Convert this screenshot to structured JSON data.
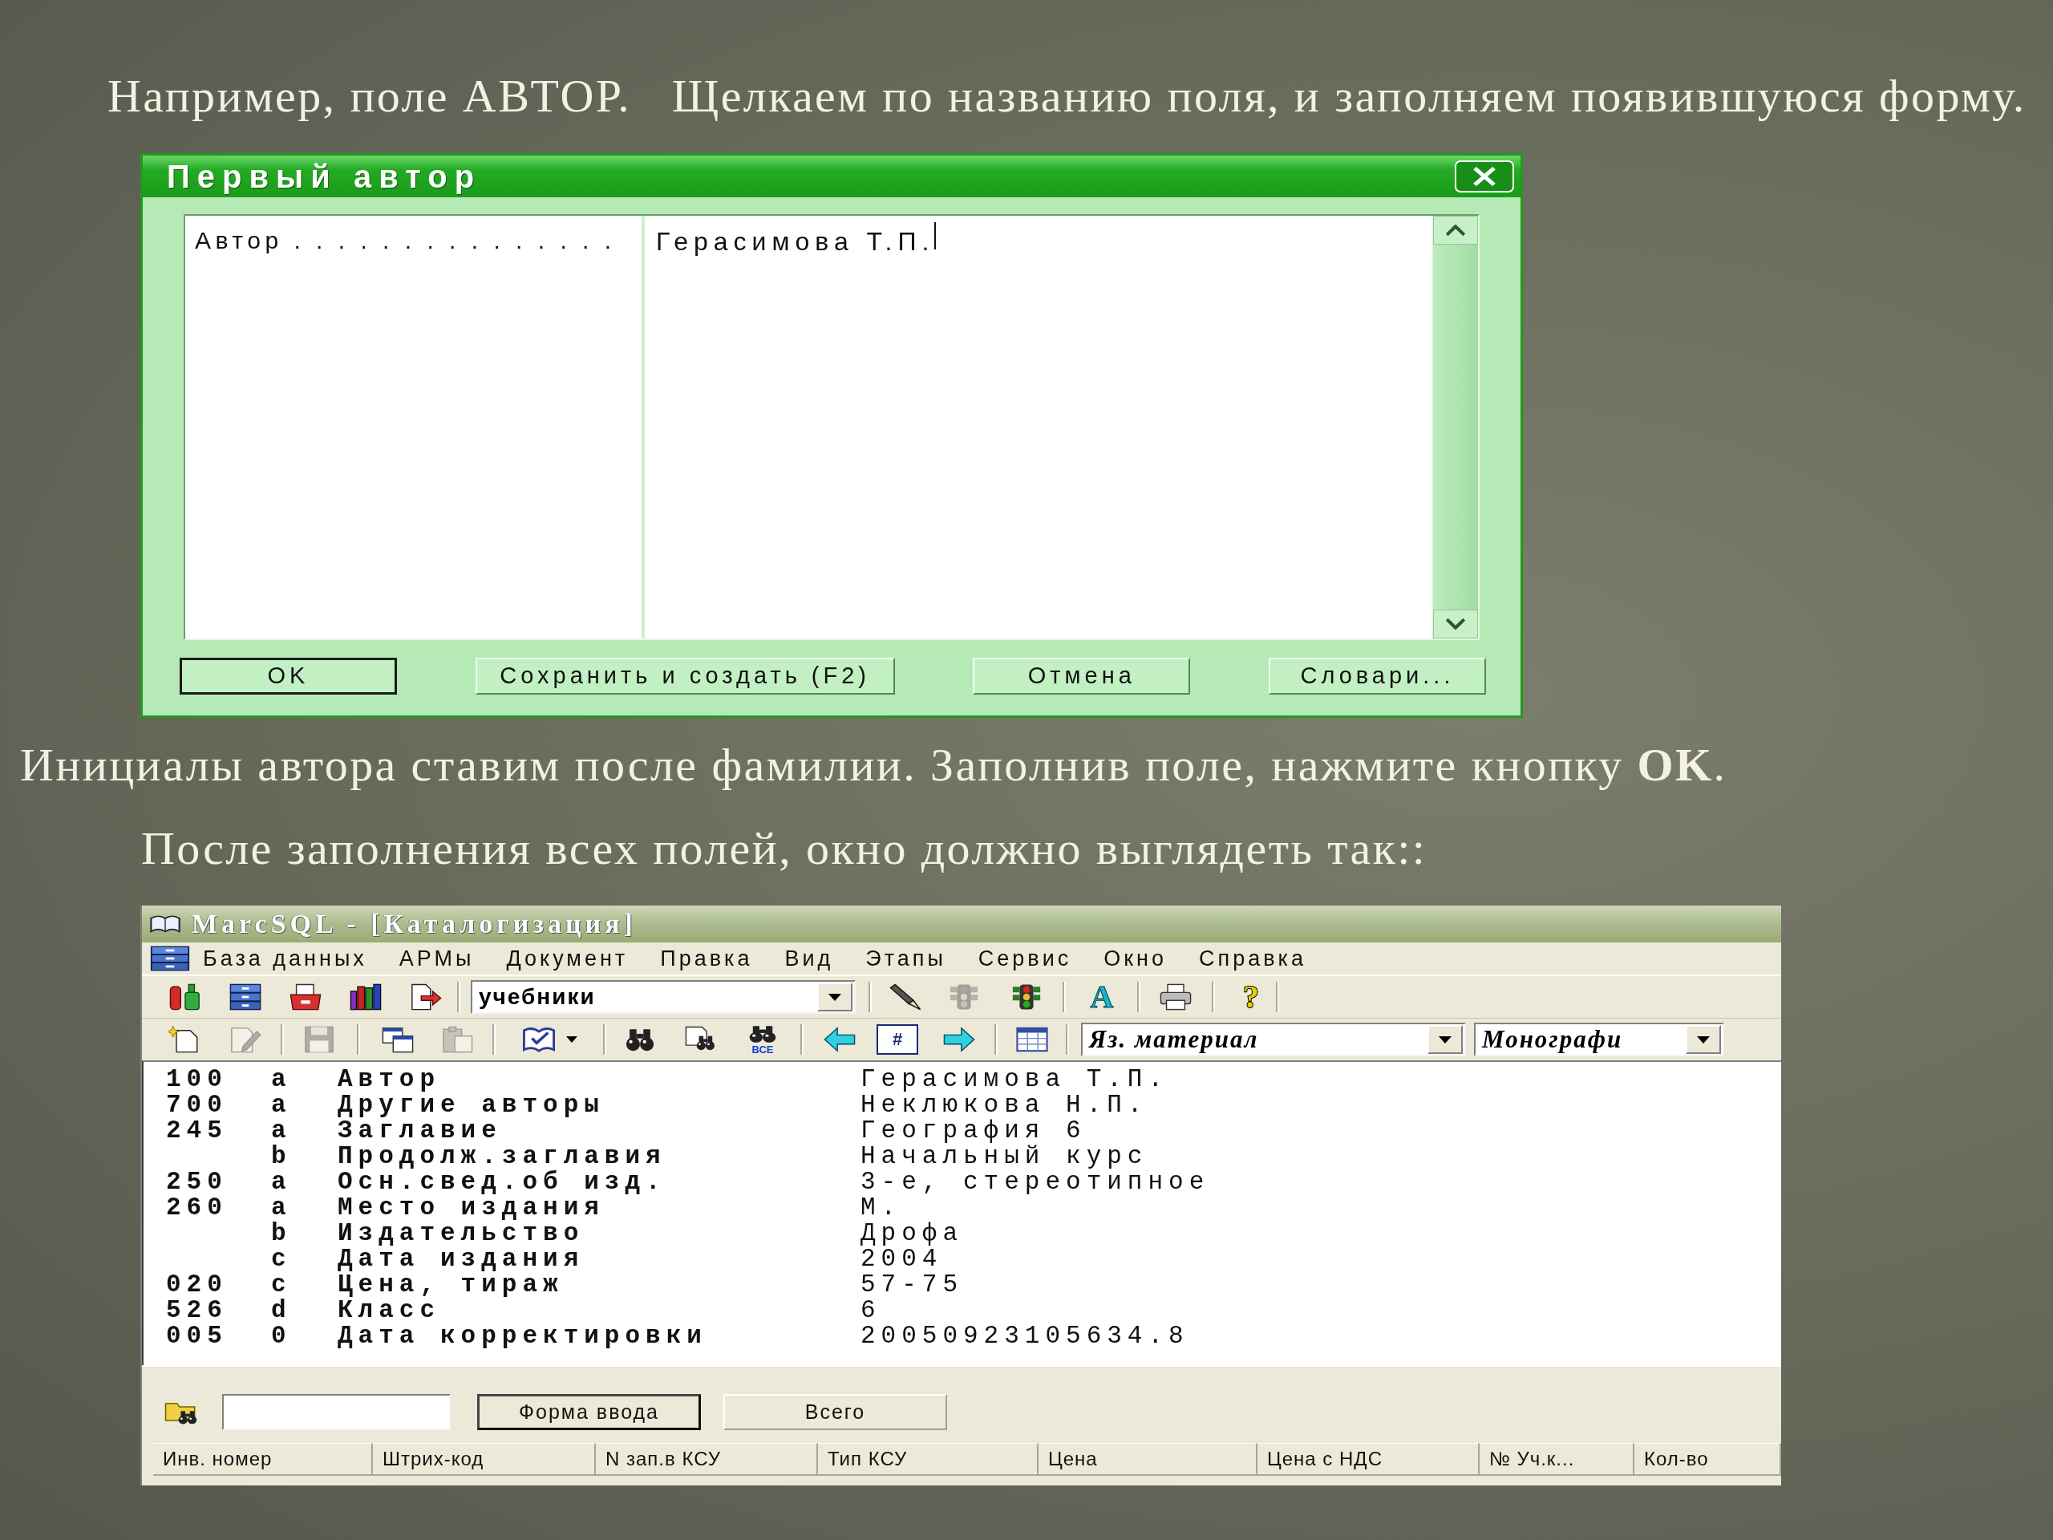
{
  "heading": "Например, поле АВТОР.   Щелкаем по названию поля, и заполняем появившуюся форму.",
  "dialog": {
    "title": "Первый автор",
    "field_label": "Автор . . . . . . . . . . . . . . .",
    "field_value": "Герасимова Т.П.",
    "focused": true,
    "buttons": [
      {
        "label": "OK",
        "default": true
      },
      {
        "label": "Сохранить и создать (F2)",
        "default": false
      },
      {
        "label": "Отмена",
        "default": false
      },
      {
        "label": "Словари...",
        "default": false
      }
    ]
  },
  "instruction": "Инициалы автора ставим после фамилии. Заполнив поле, нажмите кнопку **OK**.",
  "caption": "После заполнения всех полей, окно должно выглядеть так::",
  "window": {
    "title": "MarcSQL - [Каталогизация]",
    "menu": [
      "База данных",
      "АРМы",
      "Документ",
      "Правка",
      "Вид",
      "Этапы",
      "Сервис",
      "Окно",
      "Справка"
    ],
    "toolbar_1": {
      "left_buttons": [
        {
          "disabled": false
        },
        {
          "disabled": false
        },
        {
          "disabled": false
        },
        {
          "disabled": false
        },
        {
          "disabled": false
        }
      ],
      "combo": "учебники",
      "right_buttons": [
        {
          "disabled": false
        },
        {
          "disabled": true
        },
        {
          "disabled": false
        },
        {
          "disabled": false,
          "label": "A"
        },
        {
          "disabled": false
        },
        {
          "disabled": false,
          "label": "?"
        }
      ]
    },
    "toolbar_2": {
      "buttons": [
        {
          "disabled": false
        },
        {
          "disabled": true
        },
        {
          "disabled": true
        },
        {
          "disabled": false
        },
        {
          "disabled": true
        },
        {
          "disabled": false
        },
        {
          "disabled": false
        },
        {
          "disabled": false
        },
        {
          "disabled": false,
          "label": "ВСЕ"
        },
        {
          "disabled": false
        },
        {
          "disabled": false,
          "label": "#"
        },
        {
          "disabled": false
        },
        {
          "disabled": false
        }
      ],
      "combo_1": "Яз. материал",
      "combo_2": "Монографи"
    },
    "record_rows": [
      {
        "column_1": "100",
        "column_2": "a",
        "column_3": "Автор",
        "column_4": "Герасимова Т.П."
      },
      {
        "column_1": "700",
        "column_2": "a",
        "column_3": "Другие авторы",
        "column_4": "Неклюкова Н.П."
      },
      {
        "column_1": "245",
        "column_2": "a",
        "column_3": "Заглавие",
        "column_4": "География 6"
      },
      {
        "column_2": "b",
        "column_3": "Продолж.заглавия",
        "column_4": "Начальный курс"
      },
      {
        "column_1": "250",
        "column_2": "a",
        "column_3": "Осн.свед.об изд.",
        "column_4": "3-е, стереотипное"
      },
      {
        "column_1": "260",
        "column_2": "a",
        "column_3": "Место издания",
        "column_4": "М."
      },
      {
        "column_2": "b",
        "column_3": "Издательство",
        "column_4": "Дрофа"
      },
      {
        "column_2": "c",
        "column_3": "Дата издания",
        "column_4": "2004"
      },
      {
        "column_1": "020",
        "column_2": "c",
        "column_3": "Цена, тираж",
        "column_4": "57-75"
      },
      {
        "column_1": "526",
        "column_2": "d",
        "column_3": "Класс",
        "column_4": "6"
      },
      {
        "column_1": "005",
        "column_2": "0",
        "column_3": "Дата корректировки",
        "column_4": "20050923105634.8"
      }
    ],
    "bottom_panel": {
      "buttons": [
        {
          "label": "Форма ввода",
          "default": true
        },
        {
          "label": "Всего",
          "default": false
        }
      ],
      "columns": [
        "Инв. номер",
        "Штрих-код",
        "N зап.в КСУ",
        "Тип КСУ",
        "Цена",
        "Цена с НДС",
        "№ Уч.к...",
        "Кол-во"
      ]
    }
  }
}
